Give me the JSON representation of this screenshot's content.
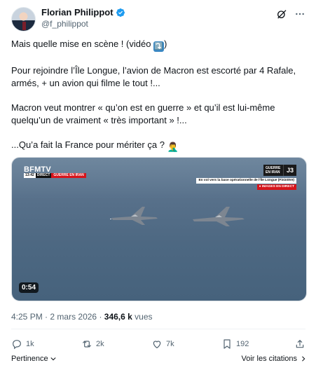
{
  "author": {
    "display_name": "Florian Philippot",
    "handle": "@f_philippot",
    "verified": true,
    "icons": [
      "verified-badge-icon",
      "grok-icon",
      "more-icon"
    ]
  },
  "tweet": {
    "line1_text": "Mais quelle mise en scène ! (vidéo ",
    "line1_emoji": "⤵️",
    "line1_end": ")",
    "paragraph2": "Pour rejoindre l’Île Longue, l’avion de Macron est escorté par 4 Rafale, armés, + un avion qui filme le tout !...",
    "paragraph3": "Macron veut montrer « qu’on est en guerre » et qu’il est lui-même quelqu’un de vraiment « très important » !...",
    "paragraph4": "...Qu’a fait la France pour mériter ça ? ",
    "paragraph4_emoji": "🤦‍♂️"
  },
  "media": {
    "channel": "BFMTV",
    "time": "13:42",
    "direct_label": "DIRECT",
    "tag": "GUERRE EN IRAN",
    "box_label": "GUERRE EN IRAN",
    "box_day": "J3",
    "caption": "En vol vers la base opérationnelle de l'Île Longue (Finistère)",
    "live_tag": "● IMAGES EN DIRECT",
    "duration": "0:54"
  },
  "meta": {
    "time": "4:25 PM",
    "separator": "·",
    "date": "2 mars 2026",
    "views_count": "346,6 k",
    "views_label": "vues"
  },
  "actions": {
    "reply_count": "1k",
    "repost_count": "2k",
    "like_count": "7k",
    "views_count": "192"
  },
  "footer": {
    "relevance_label": "Pertinence",
    "quotes_label": "Voir les citations"
  },
  "colors": {
    "text": "#0f1419",
    "secondary": "#536471",
    "verified": "#1d9bf0",
    "bfm_red": "#d6141b"
  }
}
